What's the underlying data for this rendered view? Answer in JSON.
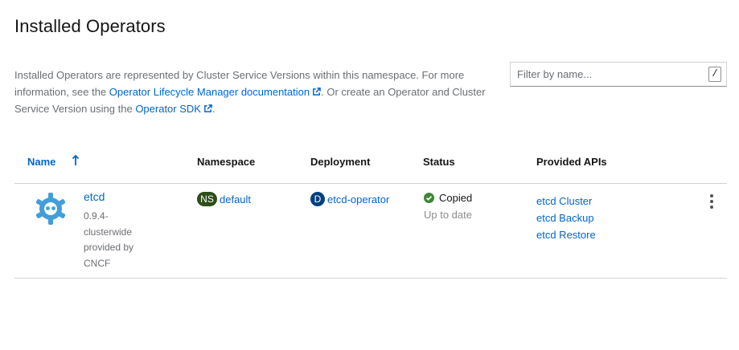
{
  "page": {
    "title": "Installed Operators"
  },
  "description": {
    "text_1": "Installed Operators are represented by Cluster Service Versions within this namespace. For more information, see the ",
    "link_1": "Operator Lifecycle Manager documentation",
    "text_2": ". Or create an Operator and Cluster Service Version using the ",
    "link_2": "Operator SDK",
    "text_3": "."
  },
  "filter": {
    "placeholder": "Filter by name...",
    "value": "",
    "shortcut_key": "/"
  },
  "table": {
    "columns": {
      "name": "Name",
      "namespace": "Namespace",
      "deployment": "Deployment",
      "status": "Status",
      "apis": "Provided APIs"
    },
    "sort": {
      "column": "name",
      "direction": "ascending",
      "icon": "arrow-up-icon"
    },
    "rows": [
      {
        "logo_icon": "etcd-logo-icon",
        "name": "etcd",
        "version_line_1": "0.9.4-",
        "version_line_2": "clusterwide",
        "provider_line_1": "provided by",
        "provider_line_2": "CNCF",
        "namespace_badge": "NS",
        "namespace": "default",
        "deployment_badge": "D",
        "deployment": "etcd-operator",
        "status": "Copied",
        "status_icon": "check-circle-icon",
        "status_color": "#3e8635",
        "status_sub": "Up to date",
        "apis": [
          "etcd Cluster",
          "etcd Backup",
          "etcd Restore"
        ]
      }
    ]
  },
  "colors": {
    "link": "#0066cc",
    "ns_badge": "#2d4d1a",
    "deployment_badge": "#004080",
    "etcd_logo": "#419eda"
  }
}
